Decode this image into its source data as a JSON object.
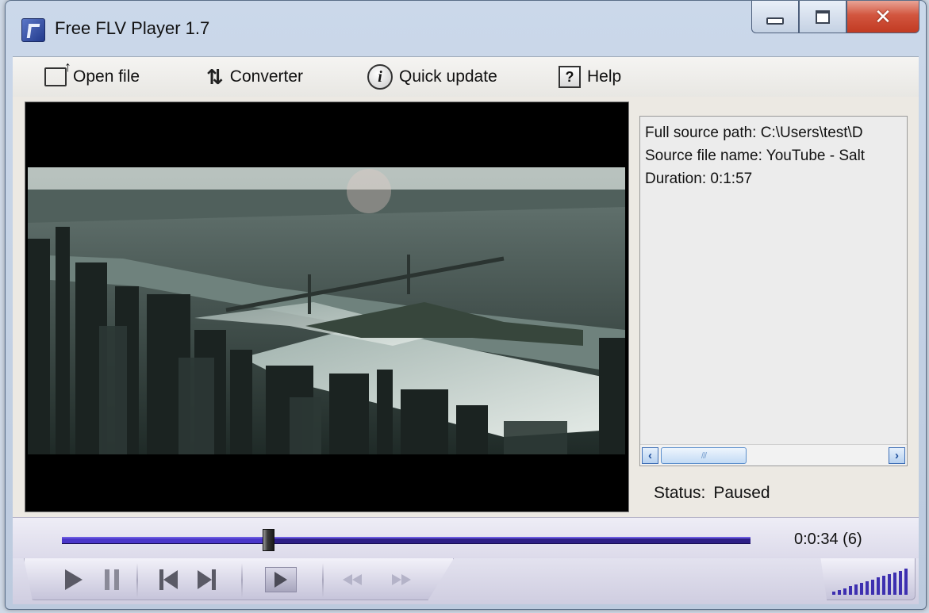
{
  "window": {
    "title": "Free FLV Player 1.7",
    "controls": [
      "minimize-icon",
      "maximize-icon",
      "close-icon"
    ]
  },
  "toolbar": {
    "items": [
      {
        "label": "Open file",
        "icon": "open-file-icon"
      },
      {
        "label": "Converter",
        "icon": "convert-arrows-icon"
      },
      {
        "label": "Quick update",
        "icon": "info-icon"
      },
      {
        "label": "Help",
        "icon": "help-icon"
      }
    ]
  },
  "info": {
    "lines": [
      "Full source path: C:\\Users\\test\\D",
      "Source file name: YouTube - Salt",
      "Duration: 0:1:57"
    ]
  },
  "status": {
    "label": "Status:",
    "value": "Paused"
  },
  "playback": {
    "time_text": "0:0:34 (6)",
    "progress": 0.298
  },
  "controls": [
    "play-icon",
    "pause-icon",
    "previous-icon",
    "next-icon",
    "frame-step-icon",
    "rewind-icon",
    "fast-forward-icon",
    "volume-icon"
  ],
  "volume": {
    "level": 1.0
  },
  "colors": {
    "seek_track": "#2d1f86",
    "close_button": "#c13a22",
    "volume_bars": "#3d2fb0"
  }
}
